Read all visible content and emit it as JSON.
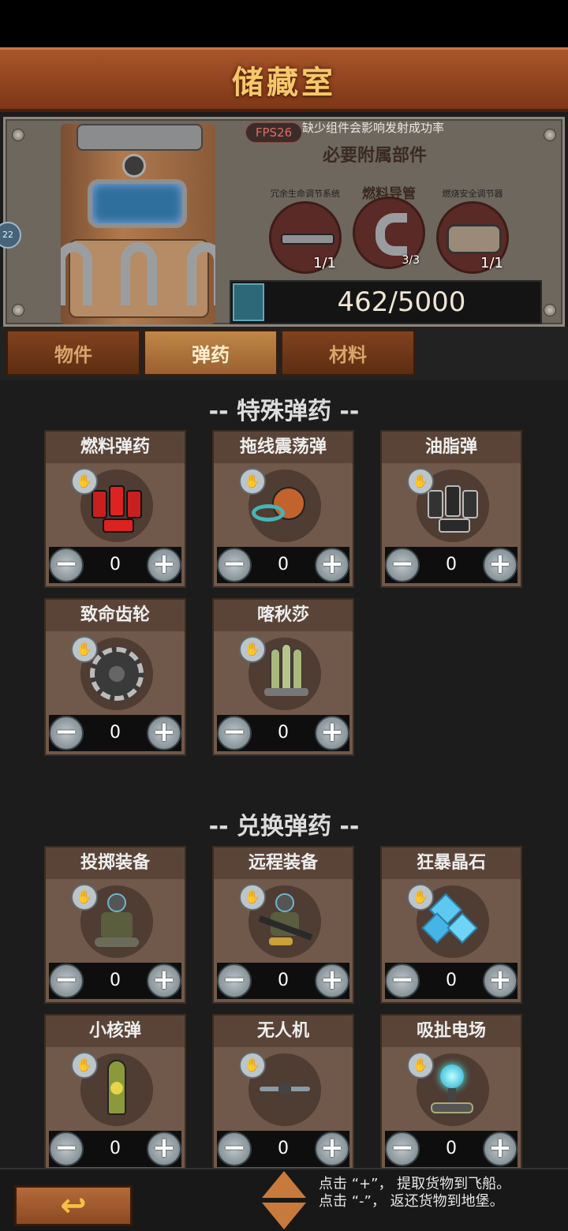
{
  "title": "储藏室",
  "fps": "FPS26",
  "side_badge": "22",
  "hint_top": "缺少组件会影响发射成功率",
  "required_title": "必要附属部件",
  "parts": [
    {
      "name": "冗余生命调节系统",
      "count": "1/1",
      "icon": "pipe-bar"
    },
    {
      "name": "燃料导管",
      "count": "3/3",
      "icon": "elbow-pipe"
    },
    {
      "name": "燃烧安全调节器",
      "count": "1/1",
      "icon": "regulator-lid"
    }
  ],
  "capacity": {
    "text": "462/5000",
    "fill_fraction": 0.0924
  },
  "tabs": [
    "物件",
    "弹药",
    "材料"
  ],
  "active_tab": 1,
  "section1": "-- 特殊弹药 --",
  "section2": "-- 兑换弹药 --",
  "special_ammo": [
    {
      "name": "燃料弹药",
      "qty": "0",
      "icon": "fuel-canisters"
    },
    {
      "name": "拖线震荡弹",
      "qty": "0",
      "icon": "tethered-bomb"
    },
    {
      "name": "油脂弹",
      "qty": "0",
      "icon": "grease-canisters"
    },
    {
      "name": "致命齿轮",
      "qty": "0",
      "icon": "saw-gear"
    },
    {
      "name": "喀秋莎",
      "qty": "0",
      "icon": "rockets"
    }
  ],
  "exchange_ammo": [
    {
      "name": "投掷装备",
      "qty": "0",
      "icon": "throw-soldier"
    },
    {
      "name": "远程装备",
      "qty": "0",
      "icon": "ranged-soldier"
    },
    {
      "name": "狂暴晶石",
      "qty": "0",
      "icon": "crystals"
    },
    {
      "name": "小核弹",
      "qty": "0",
      "icon": "nuke"
    },
    {
      "name": "无人机",
      "qty": "0",
      "icon": "drone"
    },
    {
      "name": "吸扯电场",
      "qty": "0",
      "icon": "field-orb"
    }
  ],
  "help_line1": "点击 “+”， 提取货物到飞船。",
  "help_line2": "点击 “-”， 返还货物到地堡。",
  "minus_label": "−",
  "plus_label": "+",
  "back_label": "↩"
}
